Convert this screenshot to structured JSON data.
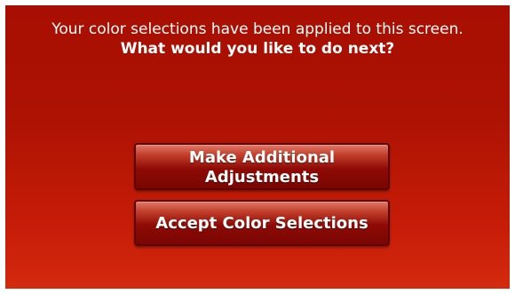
{
  "message": {
    "line1": "Your color selections have been applied to this screen.",
    "line2": "What would you like to do next?"
  },
  "buttons": {
    "adjust_line1": "Make Additional",
    "adjust_line2": "Adjustments",
    "accept": "Accept Color Selections"
  },
  "colors": {
    "background_top": "#a80f02",
    "background_bottom": "#d42a0e",
    "button_dark": "#7a0603",
    "text": "#ffffff"
  }
}
